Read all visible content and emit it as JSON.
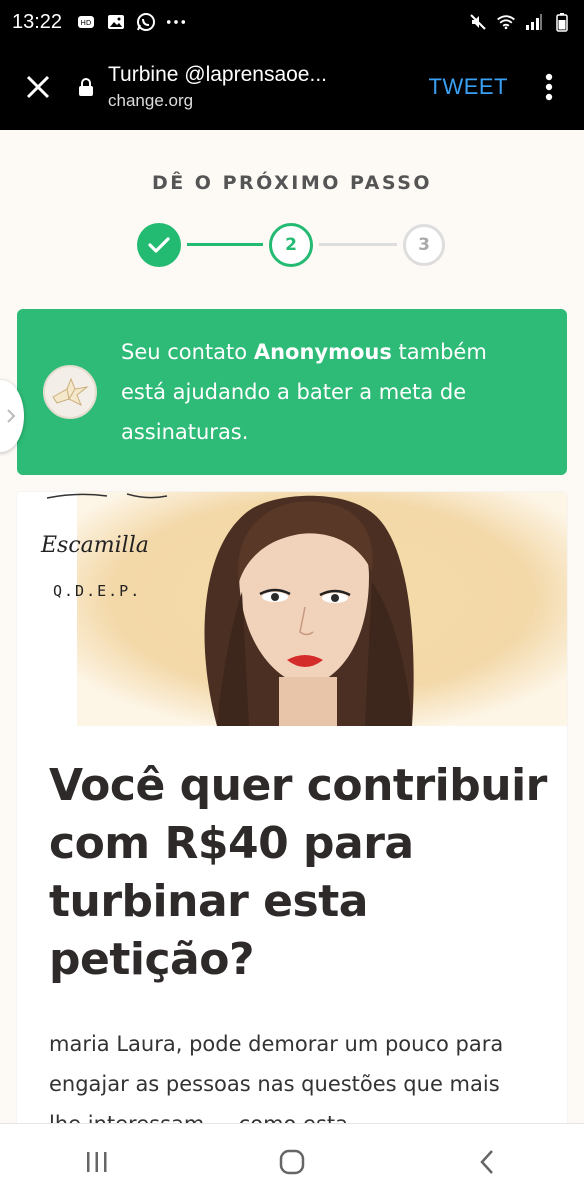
{
  "status_bar": {
    "time": "13:22",
    "left_icons": [
      "hd-icon",
      "image-icon",
      "whatsapp-icon",
      "more-dots-icon"
    ],
    "right_icons": [
      "mute-icon",
      "wifi-icon",
      "signal-icon",
      "battery-icon"
    ]
  },
  "browser": {
    "title": "Turbine @laprensaoe...",
    "url": "change.org",
    "tweet_label": "TWEET"
  },
  "stepper": {
    "heading": "DÊ O PRÓXIMO PASSO",
    "steps": [
      {
        "label": "",
        "state": "done"
      },
      {
        "label": "2",
        "state": "current"
      },
      {
        "label": "3",
        "state": "upcoming"
      }
    ]
  },
  "notice": {
    "prefix": "Seu contato ",
    "name": "Anonymous",
    "suffix": " também está ajudando a bater a meta de assinaturas."
  },
  "illustration": {
    "handwriting_line1": "Escamilla",
    "handwriting_line2": "Q.D.E.P."
  },
  "card": {
    "title": "Você quer contribuir com R$40 para turbinar esta petição?",
    "body": "maria Laura, pode demorar um pouco para engajar as pessoas nas questões que mais lhe interessam — como esta"
  },
  "colors": {
    "accent_green": "#2dbb77",
    "tweet_blue": "#3aa0f3"
  }
}
